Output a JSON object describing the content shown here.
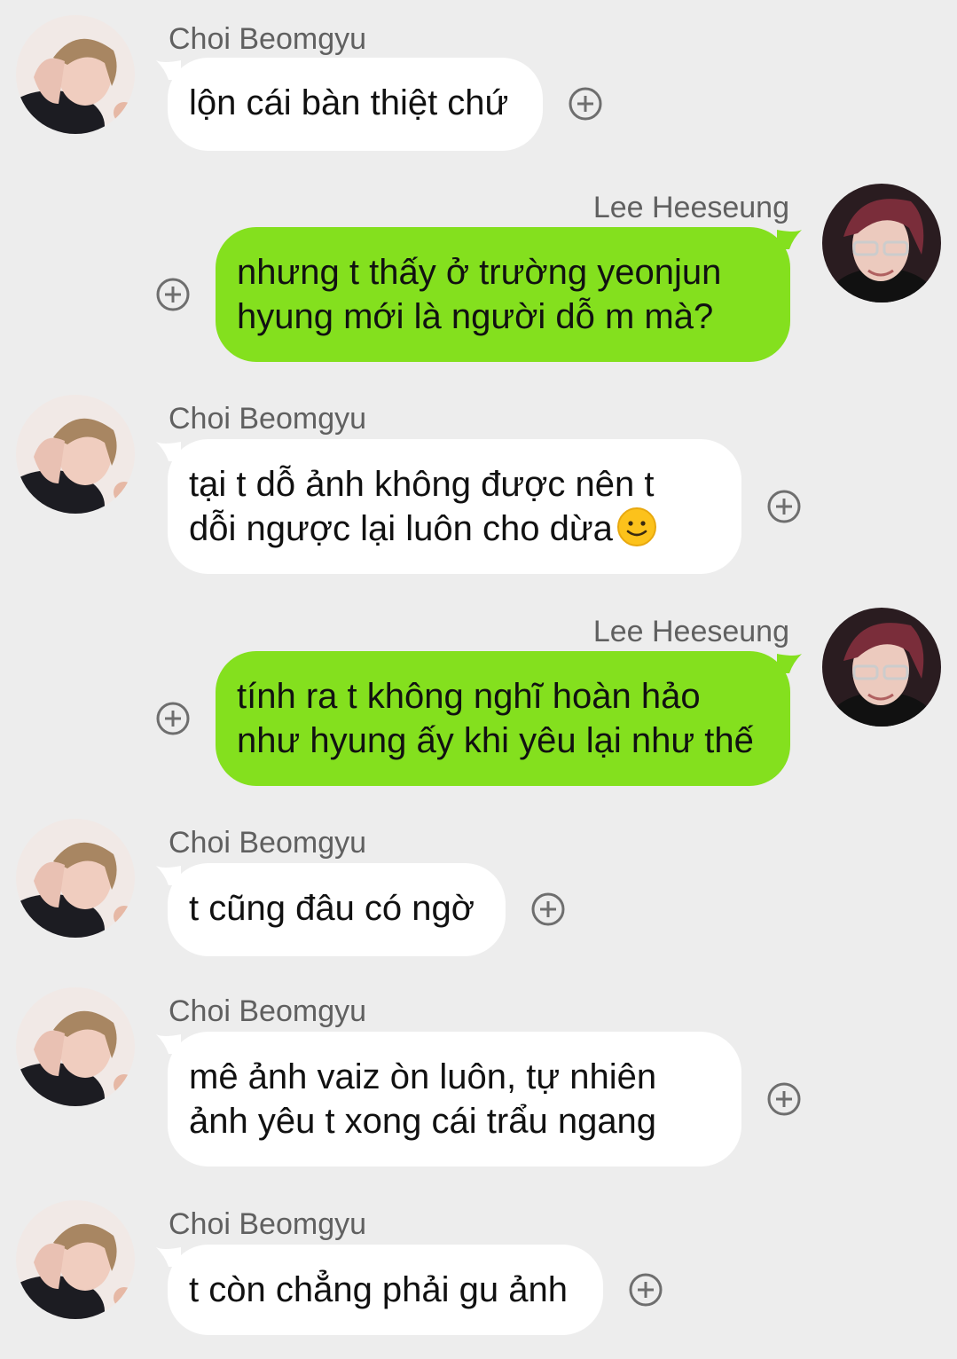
{
  "contacts": {
    "beomgyu": "Choi Beomgyu",
    "heeseung": "Lee Heeseung"
  },
  "messages": [
    {
      "sender": "Choi Beomgyu",
      "side": "in",
      "lines": [
        "lộn cái bàn thiệt chứ"
      ]
    },
    {
      "sender": "Lee Heeseung",
      "side": "out",
      "lines": [
        "nhưng t thấy ở trường yeonjun",
        "hyung mới là người dỗ m mà?"
      ]
    },
    {
      "sender": "Choi Beomgyu",
      "side": "in",
      "lines": [
        "tại t dỗ ảnh không được nên t",
        "dỗi ngược lại luôn cho dừa"
      ],
      "emoji": "slightly-smiling-face-icon"
    },
    {
      "sender": "Lee Heeseung",
      "side": "out",
      "lines": [
        "tính ra t không nghĩ hoàn hảo",
        "như hyung ấy khi yêu lại như thế"
      ]
    },
    {
      "sender": "Choi Beomgyu",
      "side": "in",
      "lines": [
        "t cũng đâu có ngờ"
      ]
    },
    {
      "sender": "Choi Beomgyu",
      "side": "in",
      "lines": [
        "mê ảnh vaiz òn luôn, tự nhiên",
        "ảnh yêu t xong cái trẩu ngang"
      ]
    },
    {
      "sender": "Choi Beomgyu",
      "side": "in",
      "lines": [
        "t còn chẳng phải gu ảnh"
      ]
    }
  ],
  "colors": {
    "background": "#ededed",
    "incoming_bubble": "#ffffff",
    "outgoing_bubble": "#84e01e",
    "sender_name": "#606060",
    "plus_icon": "#6e6e6e"
  },
  "icons": {
    "reaction": "plus-circle-icon",
    "avatar_in": "avatar-photo",
    "avatar_out": "avatar-photo"
  }
}
